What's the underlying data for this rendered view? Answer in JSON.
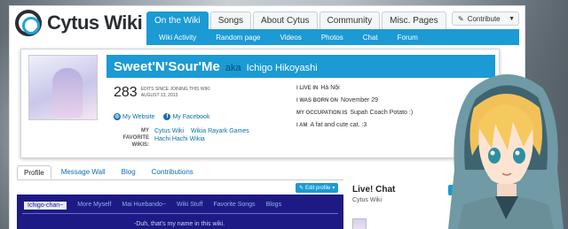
{
  "site": {
    "name": "Cytus Wiki"
  },
  "nav": {
    "tabs": [
      "On the Wiki",
      "Songs",
      "About Cytus",
      "Community",
      "Misc. Pages"
    ],
    "active": "On the Wiki",
    "subnav": [
      "Wiki Activity",
      "Random page",
      "Videos",
      "Photos",
      "Chat",
      "Forum"
    ],
    "contribute_label": "Contribute"
  },
  "profile": {
    "username": "Sweet'N'Sour'Me",
    "aka": "aka",
    "real_name": "Ichigo Hikoyashi",
    "edit_count": "283",
    "edits_label": "EDITS SINCE JOINING THIS WIKI",
    "edits_date": "AUGUST 13, 2013",
    "website_label": "My Website",
    "facebook_label": "My Facebook",
    "favorite_wikis_label": "MY FAVORITE WIKIS:",
    "favorite_wikis": [
      "Cytus Wiki",
      "Wikia Rayark Games",
      "Hachi Hachi Wikia"
    ],
    "info": [
      {
        "label": "I LIVE IN",
        "value": "Hà Nội"
      },
      {
        "label": "I WAS BORN ON",
        "value": "November 29"
      },
      {
        "label": "MY OCCUPATION IS",
        "value": "Supah Coach Potato :)"
      },
      {
        "label": "I AM",
        "value": "A fat and cute cat. :3"
      }
    ]
  },
  "profile_tabs": [
    "Profile",
    "Message Wall",
    "Blog",
    "Contributions"
  ],
  "edit_profile_label": "Edit profile",
  "panel": {
    "tabs": [
      "Ichigo-chan~",
      "More Myself",
      "Mai Huebando~",
      "Wiki Stuff",
      "Favorite Songs",
      "Blogs"
    ],
    "text": "-Duh, that's my name in this wiki."
  },
  "chat": {
    "title": "Live! Chat",
    "subtitle": "Cytus Wiki",
    "join_label": "St"
  },
  "colors": {
    "accent": "#1b9ad3",
    "panel": "#1d1a86"
  }
}
